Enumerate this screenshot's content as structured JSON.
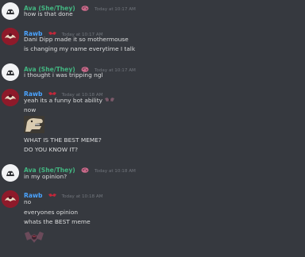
{
  "messages": [
    {
      "author": "Ava (She/They)",
      "timestamp": "Today at 10:17 AM",
      "lines": [
        "how is that done"
      ]
    },
    {
      "author": "Rawb",
      "timestamp": "Today at 10:17 AM",
      "lines": [
        "Dani Dipp made it so mothermouse",
        "is changing my name everytime I talk"
      ]
    },
    {
      "author": "Ava (She/They)",
      "timestamp": "Today at 10:17 AM",
      "lines": [
        "i thought i was tripping ngl"
      ]
    },
    {
      "author": "Rawb",
      "timestamp": "Today at 10:18 AM",
      "lines": [
        "yeah its a funny bot ability",
        "now",
        "WHAT IS THE BEST MEME?",
        "DO YOU KNOW IT?"
      ]
    },
    {
      "author": "Ava (She/They)",
      "timestamp": "Today at 10:18 AM",
      "lines": [
        "in my opinion?"
      ]
    },
    {
      "author": "Rawb",
      "timestamp": "Today at 10:18 AM",
      "lines": [
        "no",
        "everyones opinion",
        "whats the BEST meme"
      ]
    }
  ],
  "icons": {
    "ava_badge": "spotted-pig-badge-icon",
    "rawb_badge": "red-bat-badge-icon",
    "bat_emoji": "bat-emoji-icon",
    "dino_sticker": "dinosaur-meme-image"
  },
  "colors": {
    "background": "#36393f",
    "ava_name": "#43b581",
    "rawb_name": "#4aa3ff",
    "text": "#dcddde",
    "timestamp": "#72767d"
  }
}
